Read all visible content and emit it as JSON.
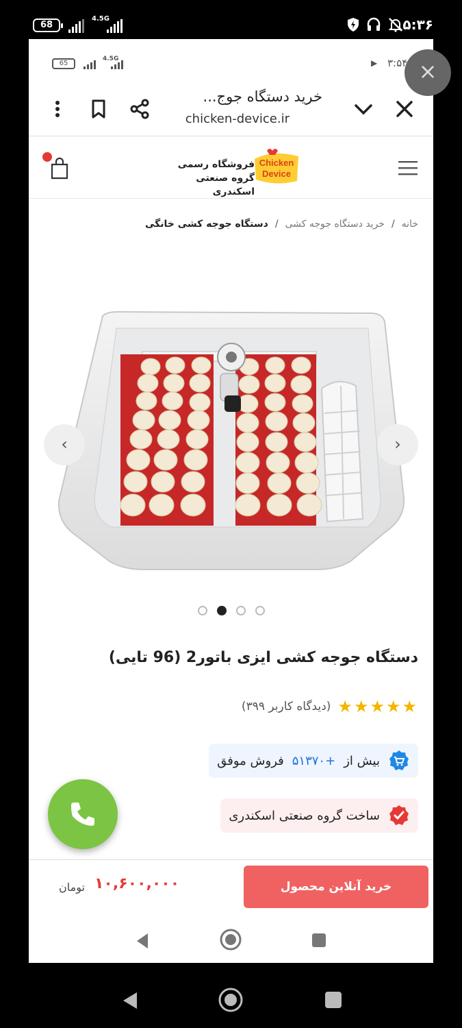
{
  "outer_status": {
    "battery": "68",
    "network": "4.5G",
    "time": "۵:۳۶"
  },
  "inner_status": {
    "battery": "65",
    "network": "4.5G",
    "time": "۳:۵۴"
  },
  "close_bubble": {
    "icon": "close-icon"
  },
  "browser": {
    "title": "خرید دستگاه جوج...",
    "url": "chicken-device.ir",
    "icons": [
      "more-vert-icon",
      "bookmark-icon",
      "share-icon",
      "chevron-down-icon",
      "close-icon"
    ]
  },
  "site": {
    "logo_line1": "فروشگاه رسمی",
    "logo_line2": "گروه صنعتی اسکندری",
    "logo_en1": "Chicken",
    "logo_en2": "Device"
  },
  "breadcrumb": {
    "home": "خانه",
    "category": "خرید دستگاه جوجه کشی",
    "current": "دستگاه جوجه کشی خانگی",
    "separator": "/"
  },
  "gallery": {
    "slides": 4,
    "active_slide": 2
  },
  "product": {
    "title": "دستگاه جوجه کشی ایزی باتور2 (96 تایی)",
    "rating_stars": 5,
    "review_count_text": "(دیدگاه کاربر ۳۹۹)",
    "sales_prefix": "بیش از",
    "sales_count": "+۵۱۳۷۰",
    "sales_suffix": "فروش موفق",
    "maker": "ساخت گروه صنعتی اسکندری"
  },
  "buy": {
    "button_label": "خرید آنلاین محصول",
    "price": "۱۰,۶۰۰,۰۰۰",
    "currency": "تومان"
  },
  "colors": {
    "accent": "#f06262",
    "price": "#e53935",
    "call": "#7cc443",
    "star": "#f5b400",
    "link_blue": "#1e6fd9"
  }
}
